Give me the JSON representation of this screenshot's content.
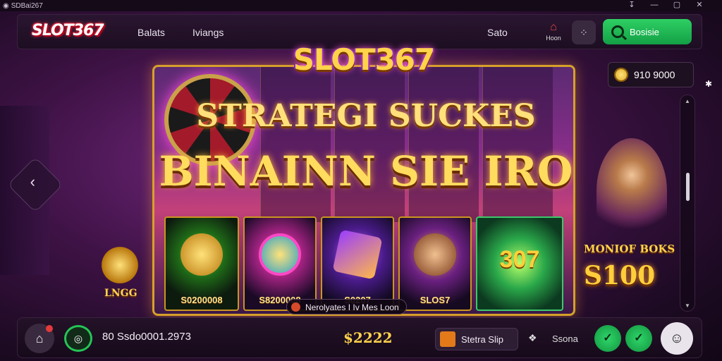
{
  "window": {
    "title": "SDBai267",
    "controls": [
      "↧",
      "—",
      "▢",
      "✕"
    ]
  },
  "header": {
    "logo": "SLOT367",
    "nav": [
      "Balats",
      "Iviangs",
      "Sato"
    ],
    "home_label": "Hoon",
    "cta_label": "Bosisie"
  },
  "balance": {
    "amount": "910 9000"
  },
  "hero": {
    "brand": "SLOT367",
    "headline1": "STRATEGI SUCKES",
    "headline2": "BINAINN SIE IRO",
    "tiles": [
      {
        "caption": "S0200008"
      },
      {
        "caption": "S8200008"
      },
      {
        "caption": "S0207"
      },
      {
        "caption": "SLOS7"
      },
      {
        "caption": "307"
      }
    ],
    "tooltip": "Nerolyates I Iv Mes Loon"
  },
  "promos": {
    "left": "LNGG",
    "right_title": "MONIOF BOKS",
    "right_value": "S100"
  },
  "bottom": {
    "balance": "80 Ssdo0001.2973",
    "bet": "$2222",
    "slip_label": "Stetra Slip",
    "store_label": "Ssona"
  },
  "colors": {
    "accent_green": "#22c55e",
    "gold": "#ffd34a",
    "brand_red": "#d7263d",
    "background": "#3e1245"
  },
  "icons": {
    "home": "house-icon",
    "grid": "grid-dots-icon",
    "search": "search-icon",
    "coin": "coin-icon",
    "user": "user-icon"
  }
}
